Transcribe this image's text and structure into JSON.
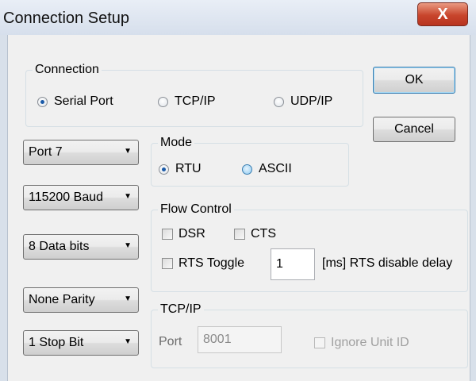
{
  "window": {
    "title": "Connection Setup",
    "close_label": "X"
  },
  "buttons": {
    "ok": "OK",
    "cancel": "Cancel"
  },
  "connection": {
    "legend": "Connection",
    "options": [
      "Serial Port",
      "TCP/IP",
      "UDP/IP"
    ],
    "selected": "Serial Port"
  },
  "selects": {
    "port": "Port 7",
    "baud": "115200 Baud",
    "data_bits": "8 Data bits",
    "parity": "None Parity",
    "stop_bits": "1 Stop Bit"
  },
  "mode": {
    "legend": "Mode",
    "options": [
      "RTU",
      "ASCII"
    ],
    "selected": "RTU"
  },
  "flow_control": {
    "legend": "Flow Control",
    "dsr": "DSR",
    "cts": "CTS",
    "rts_toggle": "RTS Toggle",
    "delay_value": "1",
    "delay_label": "[ms] RTS disable delay"
  },
  "tcpip": {
    "legend": "TCP/IP",
    "port_label": "Port",
    "port_value": "8001",
    "ignore_unit_id": "Ignore Unit ID"
  },
  "colors": {
    "title_bar": "#dbe3ee",
    "close_button": "#c8452c",
    "dialog_bg": "#f0f0f0"
  }
}
